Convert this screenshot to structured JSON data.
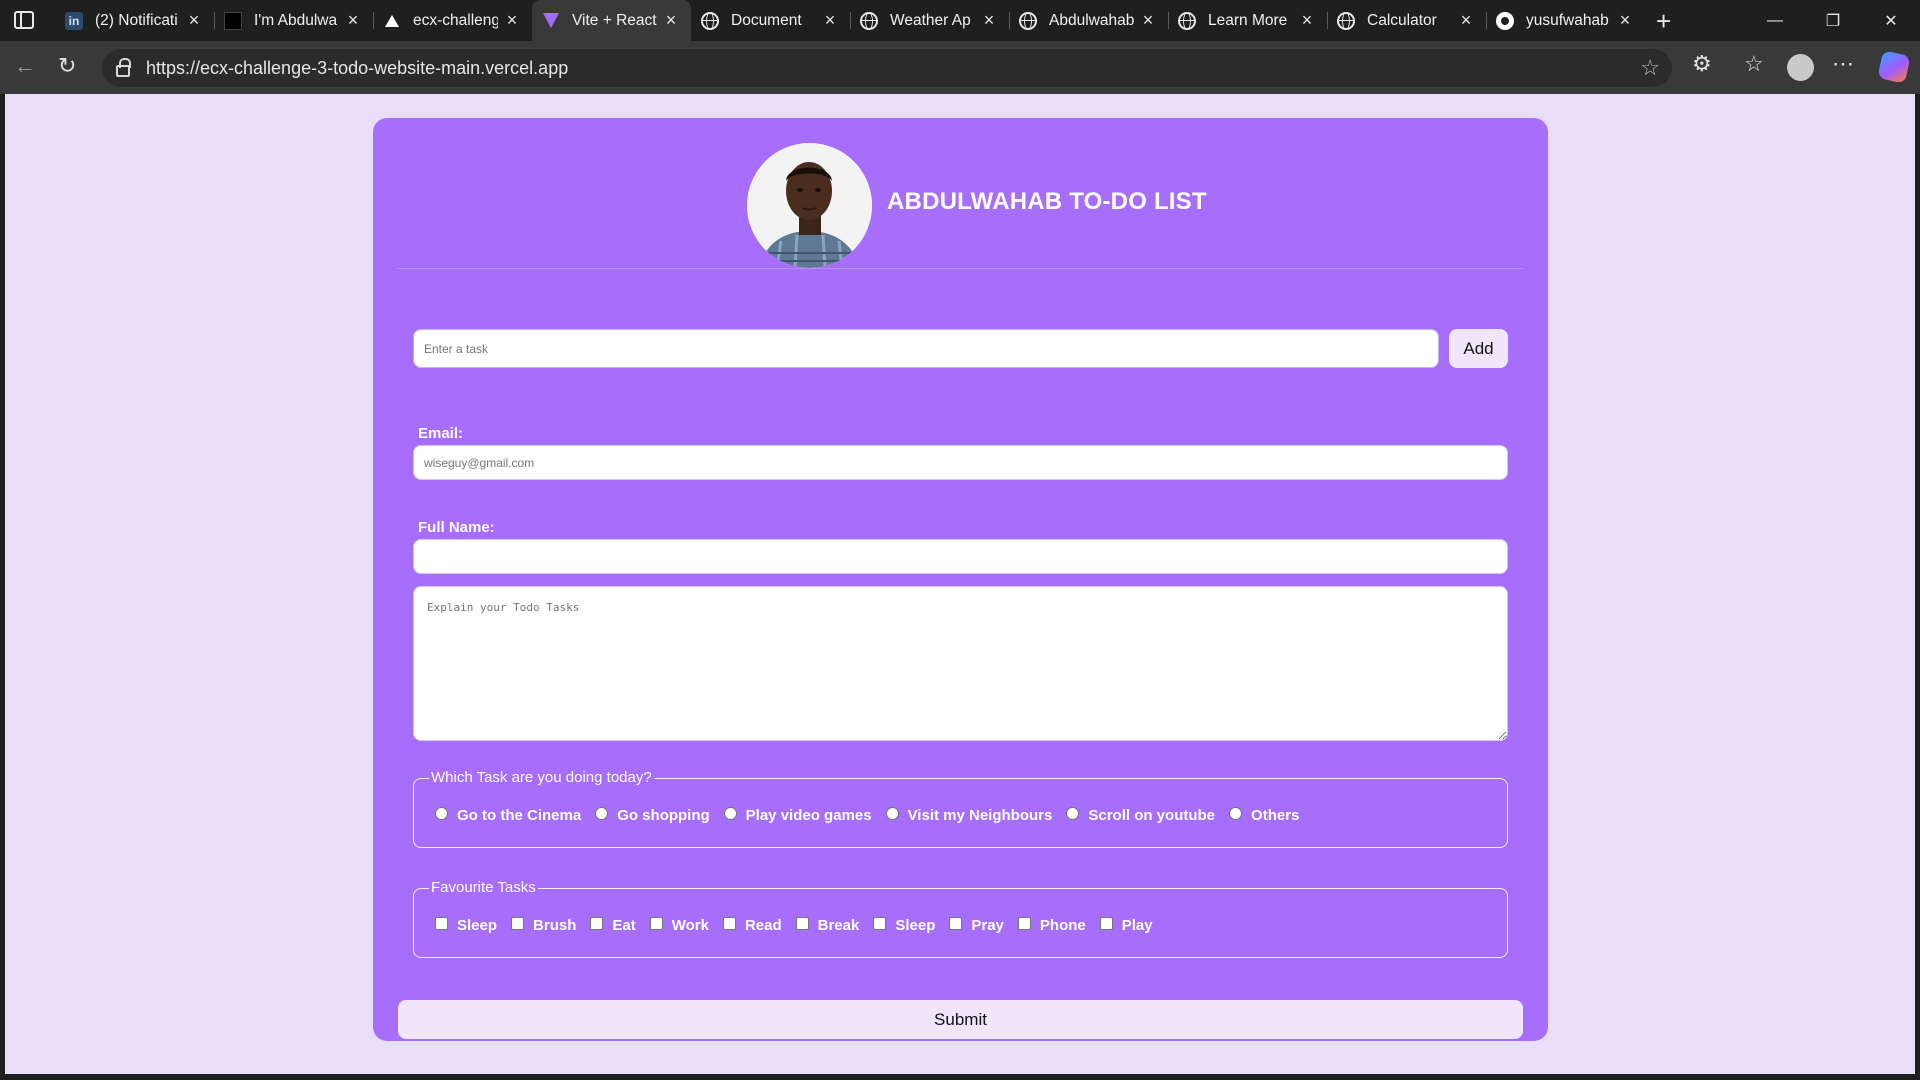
{
  "browser": {
    "tabs": [
      {
        "title": "(2) Notificati",
        "icon": "linkedin-icon",
        "icon_text": "in"
      },
      {
        "title": "I'm Abdulwa",
        "icon": "dark-site-icon"
      },
      {
        "title": "ecx-challeng",
        "icon": "vercel-icon"
      },
      {
        "title": "Vite + React",
        "icon": "vite-icon",
        "active": true
      },
      {
        "title": "Document",
        "icon": "globe-icon"
      },
      {
        "title": "Weather Ap",
        "icon": "globe-icon"
      },
      {
        "title": "Abdulwahab",
        "icon": "globe-icon"
      },
      {
        "title": "Learn More",
        "icon": "globe-icon"
      },
      {
        "title": "Calculator",
        "icon": "globe-icon"
      },
      {
        "title": "yusufwahab",
        "icon": "github-icon"
      }
    ],
    "url": "https://ecx-challenge-3-todo-website-main.vercel.app"
  },
  "page": {
    "title": "ABDULWAHAB TO-DO LIST",
    "task_input": {
      "placeholder": "Enter a task",
      "value": ""
    },
    "add_label": "Add",
    "email": {
      "label": "Email:",
      "placeholder": "wiseguy@gmail.com",
      "value": ""
    },
    "fullname": {
      "label": "Full Name:",
      "placeholder": "",
      "value": ""
    },
    "todo_textarea": {
      "placeholder": "Explain your Todo Tasks",
      "value": ""
    },
    "today_task": {
      "legend": "Which Task are you doing today?",
      "options": [
        "Go to the Cinema",
        "Go shopping",
        "Play video games",
        "Visit my Neighbours",
        "Scroll on youtube",
        "Others"
      ]
    },
    "favourite_tasks": {
      "legend": "Favourite Tasks",
      "options": [
        "Sleep",
        "Brush",
        "Eat",
        "Work",
        "Read",
        "Break",
        "Sleep",
        "Pray",
        "Phone",
        "Play"
      ]
    },
    "submit_label": "Submit"
  },
  "colors": {
    "card_background": "#a76dfb",
    "page_background": "#e9def7",
    "button_background": "#efe6fb"
  }
}
